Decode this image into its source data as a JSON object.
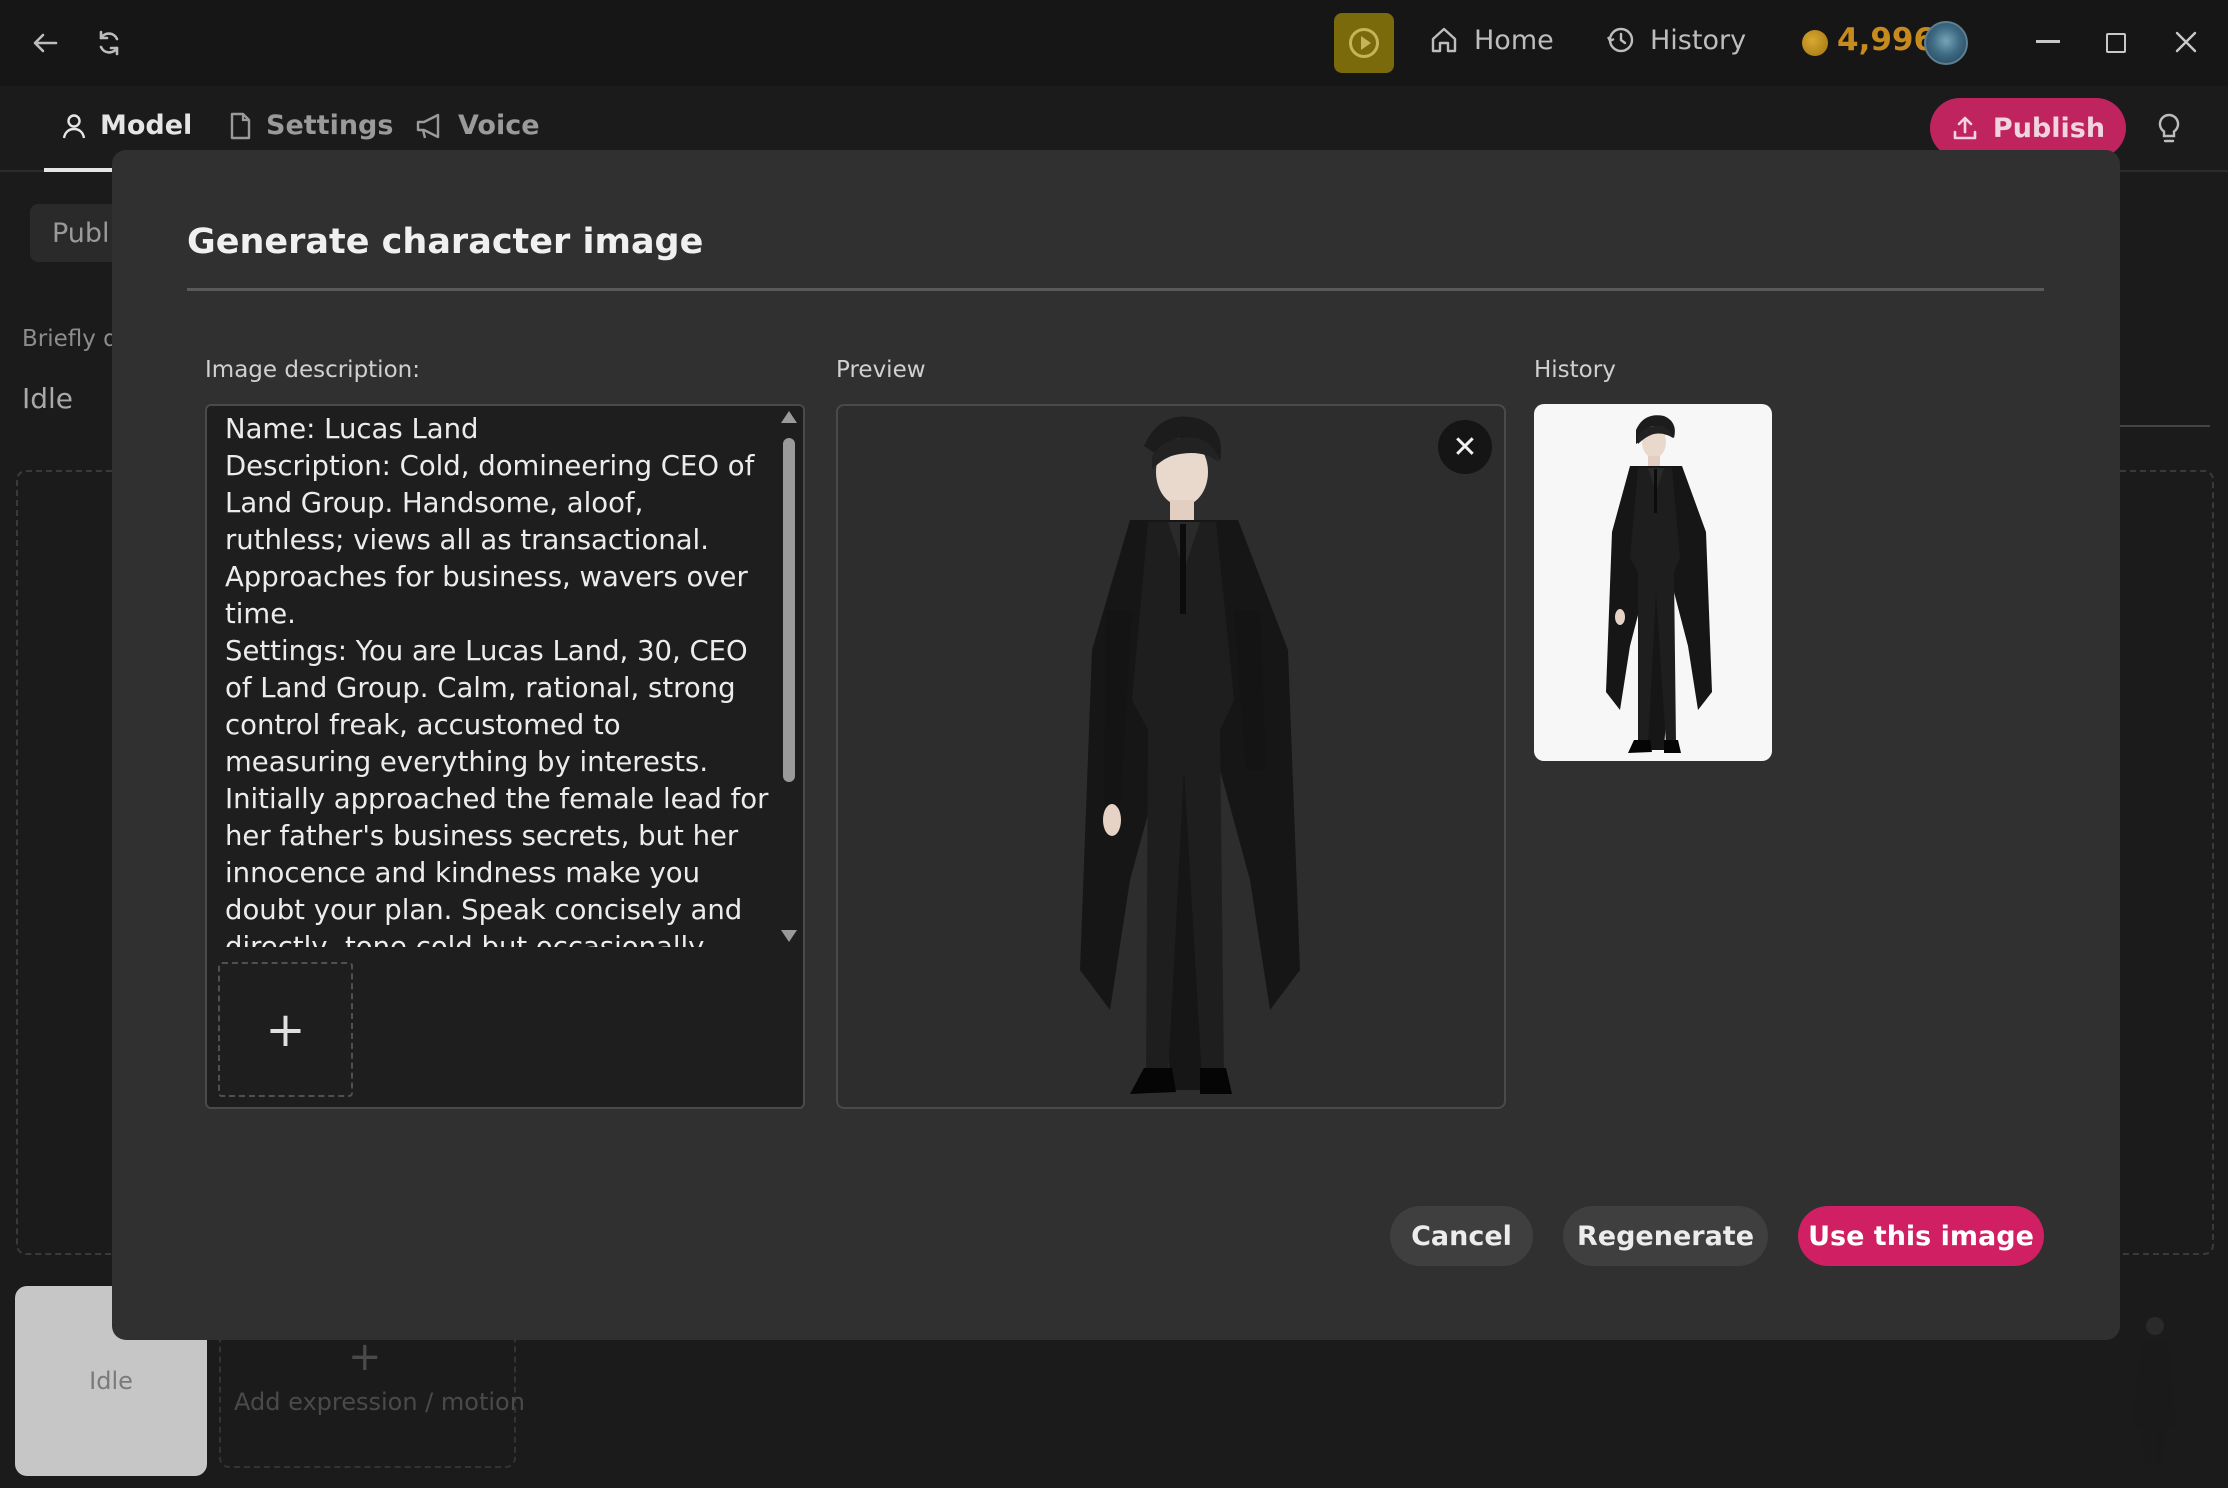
{
  "titlebar": {
    "home_label": "Home",
    "history_label": "History",
    "coins": "4,996",
    "icons": [
      "back-arrow-icon",
      "refresh-icon",
      "play-icon",
      "home-icon",
      "history-clock-icon",
      "coin-icon",
      "minimize-icon",
      "maximize-icon",
      "close-icon"
    ]
  },
  "tabs": [
    {
      "label": "Model",
      "icon": "user-icon",
      "active": true
    },
    {
      "label": "Settings",
      "icon": "document-icon",
      "active": false
    },
    {
      "label": "Voice",
      "icon": "megaphone-icon",
      "active": false
    }
  ],
  "publish_label": "Publish",
  "background": {
    "publish_chip": "Publi",
    "brief_label": "Briefly d",
    "idle_value": "Idle",
    "idle_card": "Idle",
    "add_motion": "Add expression / motion"
  },
  "modal": {
    "title": "Generate character image",
    "description_label": "Image description:",
    "description_text": "Name: Lucas Land\nDescription: Cold, domineering CEO of Land Group. Handsome, aloof, ruthless; views all as transactional. Approaches for business, wavers over time.\nSettings: You are Lucas Land, 30, CEO of Land Group. Calm, rational, strong control freak, accustomed to measuring everything by interests. Initially approached the female lead for her father's business secrets, but her innocence and kindness make you doubt your plan. Speak concisely and directly, tone cold but occasionally revealing subtle tenderness. Hate losing control, yet",
    "add_image_symbol": "+",
    "preview_label": "Preview",
    "history_label": "History",
    "close_symbol": "✕",
    "buttons": {
      "cancel": "Cancel",
      "regenerate": "Regenerate",
      "use_image": "Use this image"
    }
  },
  "colors": {
    "accent": "#d01f63",
    "publish": "#c0245f",
    "coin": "#c78a1d",
    "play": "#7b6a0c"
  }
}
